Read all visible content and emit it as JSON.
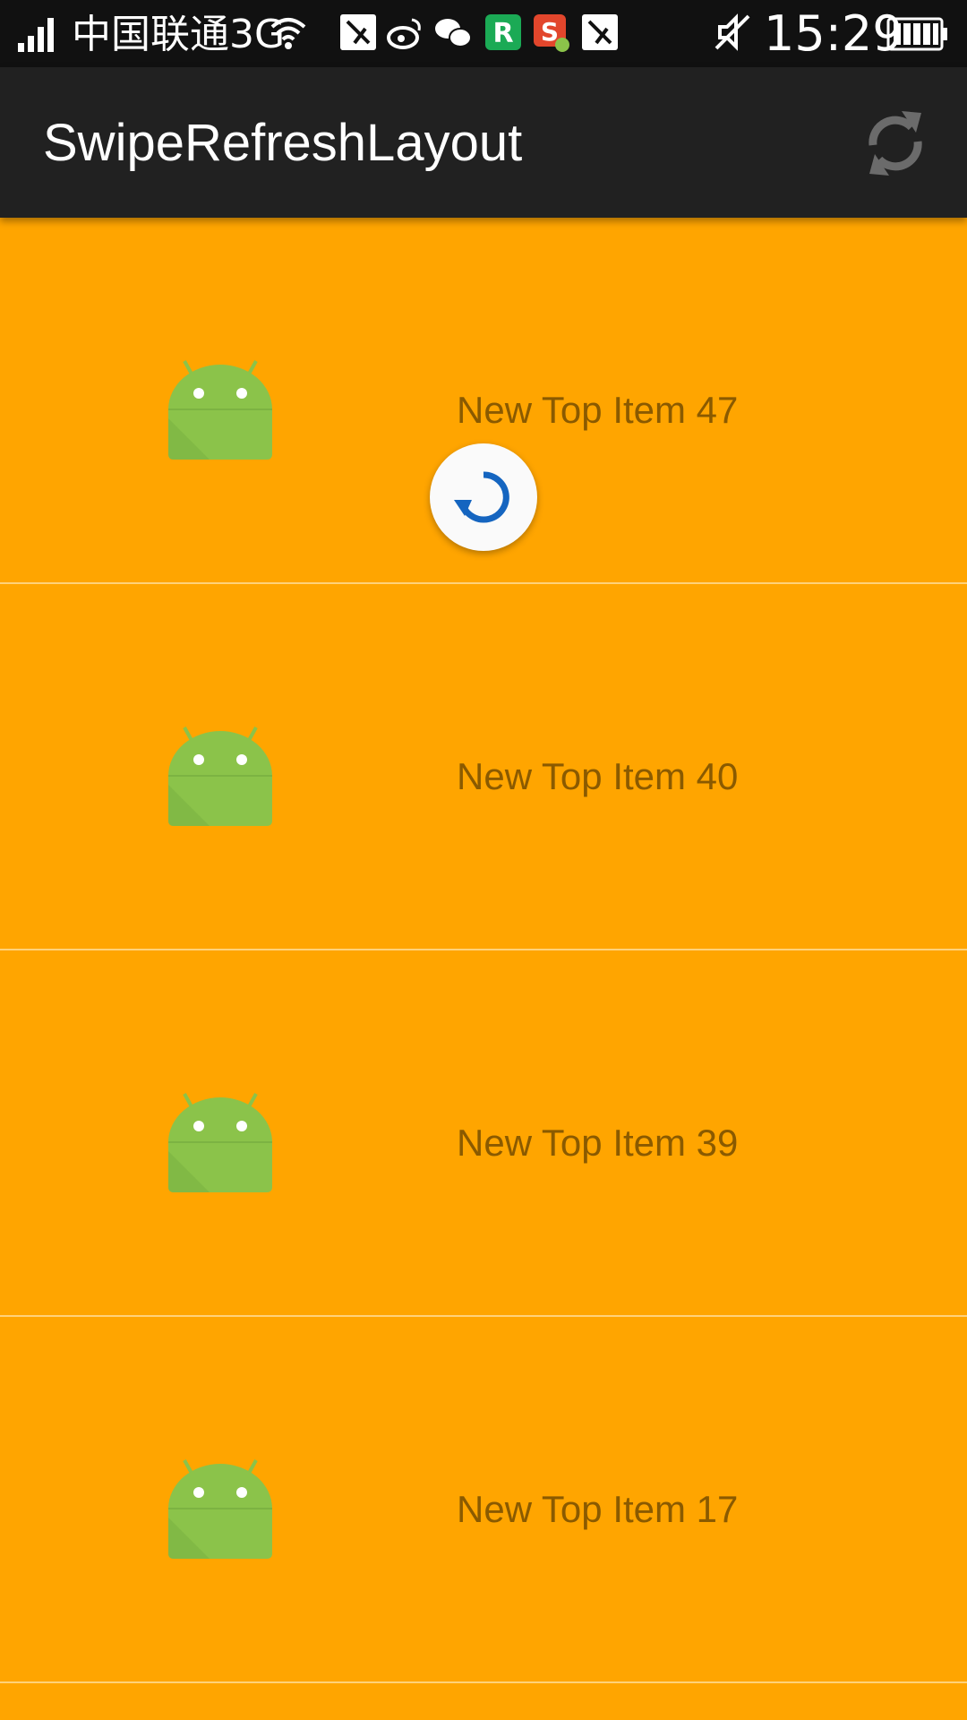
{
  "status_bar": {
    "carrier": "中国联通3G",
    "time": "15:29",
    "icons": [
      "signal-icon",
      "wifi-icon",
      "app-notification-icon",
      "weibo-icon",
      "wechat-icon",
      "r-app-icon",
      "s-app-icon",
      "app-notification-icon",
      "mute-icon",
      "battery-icon"
    ]
  },
  "app_bar": {
    "title": "SwipeRefreshLayout",
    "refresh_icon": "refresh-icon"
  },
  "list": {
    "items": [
      {
        "label": "New Top Item 47",
        "icon": "android-icon"
      },
      {
        "label": "New Top Item 40",
        "icon": "android-icon"
      },
      {
        "label": "New Top Item 39",
        "icon": "android-icon"
      },
      {
        "label": "New Top Item 17",
        "icon": "android-icon"
      }
    ]
  },
  "refresh_indicator": {
    "icon": "spinner-icon",
    "color": "#1565C0"
  },
  "colors": {
    "status_bar": "#111111",
    "app_bar": "#212121",
    "list_background": "#FFA500",
    "item_text": "#8a5a00",
    "android_green": "#8BC34A"
  }
}
